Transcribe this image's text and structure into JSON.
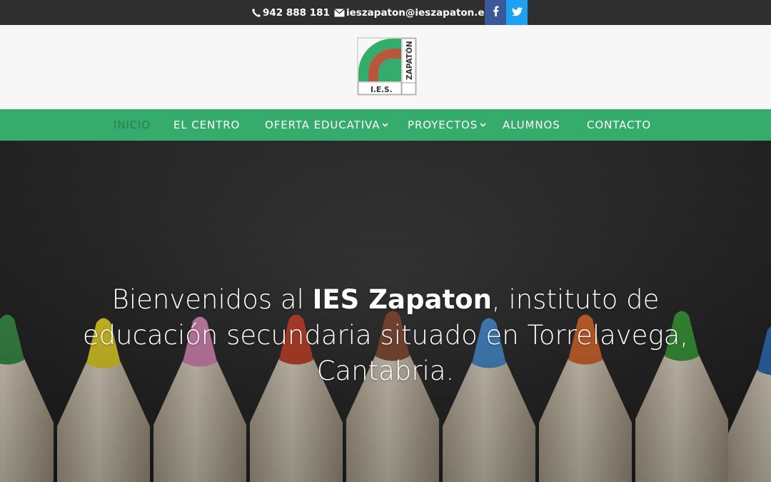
{
  "topbar": {
    "phone_icon": "phone-icon",
    "phone": "942 888 181",
    "email_icon": "envelope-icon",
    "email": "ieszapaton@ieszapaton.es",
    "social": [
      {
        "name": "facebook",
        "icon": "facebook-icon",
        "color": "#3b5998"
      },
      {
        "name": "twitter",
        "icon": "twitter-icon",
        "color": "#1da1f2"
      }
    ],
    "background": "#2f2f2f"
  },
  "logo": {
    "text_vertical": "ZAPATÓN",
    "text_bottom": "I.E.S.",
    "colors": {
      "green": "#35ab6c",
      "brown": "#b5583b"
    }
  },
  "nav": {
    "background": "#35ab6c",
    "items": [
      {
        "label": "INICIO",
        "active": true,
        "dropdown": false
      },
      {
        "label": "EL CENTRO",
        "active": false,
        "dropdown": false
      },
      {
        "label": "OFERTA EDUCATIVA",
        "active": false,
        "dropdown": true
      },
      {
        "label": "PROYECTOS",
        "active": false,
        "dropdown": true
      },
      {
        "label": "ALUMNOS",
        "active": false,
        "dropdown": false
      },
      {
        "label": "CONTACTO",
        "active": false,
        "dropdown": false
      }
    ]
  },
  "hero": {
    "text_pre": "Bienvenidos al ",
    "text_bold": "IES Zapaton",
    "text_post": ", instituto de educación secundaria situado en Torrelavega, Cantabria.",
    "pencil_colors": [
      "#3a8f48",
      "#e6d22a",
      "#d88ab8",
      "#c6452e",
      "#8a4f3a",
      "#4a8fd0",
      "#d66a2e",
      "#3c9a3a",
      "#2f6fb8"
    ]
  }
}
